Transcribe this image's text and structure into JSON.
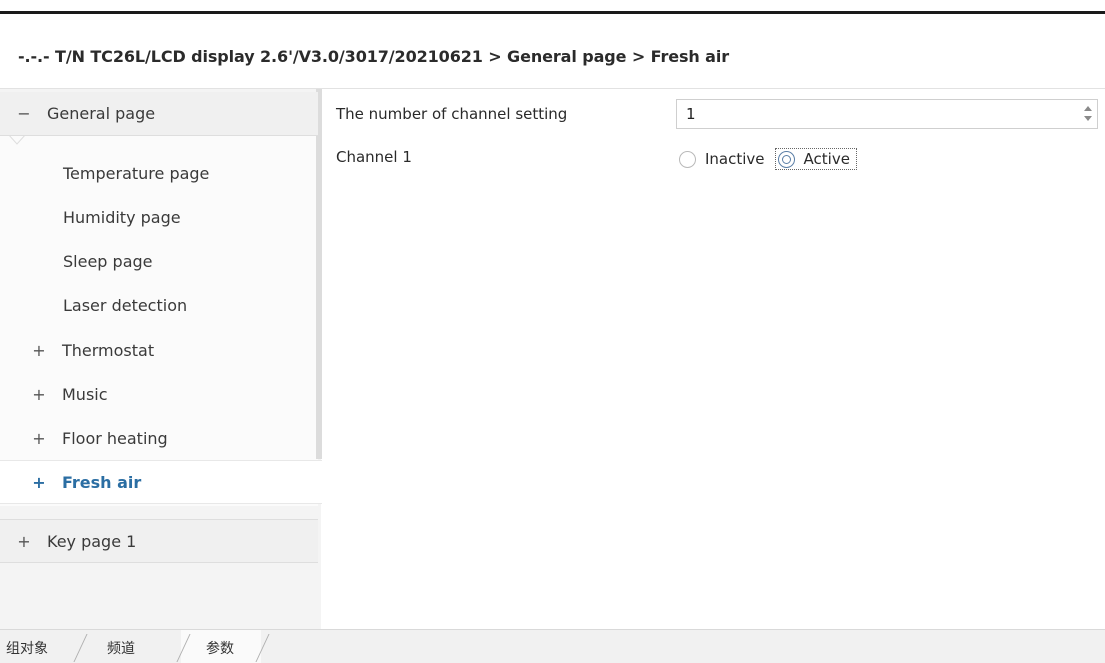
{
  "breadcrumb": "-.-.- T/N TC26L/LCD display 2.6'/V3.0/3017/20210621 > General page > Fresh air",
  "sidebar": {
    "group_general": {
      "glyph": "−",
      "label": "General page"
    },
    "items": [
      {
        "label": "Temperature page"
      },
      {
        "label": "Humidity page"
      },
      {
        "label": "Sleep page"
      },
      {
        "label": "Laser detection"
      },
      {
        "glyph": "+",
        "label": "Thermostat"
      },
      {
        "glyph": "+",
        "label": "Music"
      },
      {
        "glyph": "+",
        "label": "Floor heating"
      },
      {
        "glyph": "+",
        "label": "Fresh air"
      }
    ],
    "group_key": {
      "glyph": "+",
      "label": "Key page 1"
    }
  },
  "main": {
    "channel_setting_label": "The number of channel setting",
    "channel_setting_value": "1",
    "channel1_label": "Channel 1",
    "radio_inactive": "Inactive",
    "radio_active": "Active",
    "selected_option": "Active"
  },
  "tabs": [
    "组对象",
    "频道",
    "参数"
  ],
  "colors": {
    "accent": "#2b6ea3",
    "sidebar_bg": "#f4f4f4"
  }
}
